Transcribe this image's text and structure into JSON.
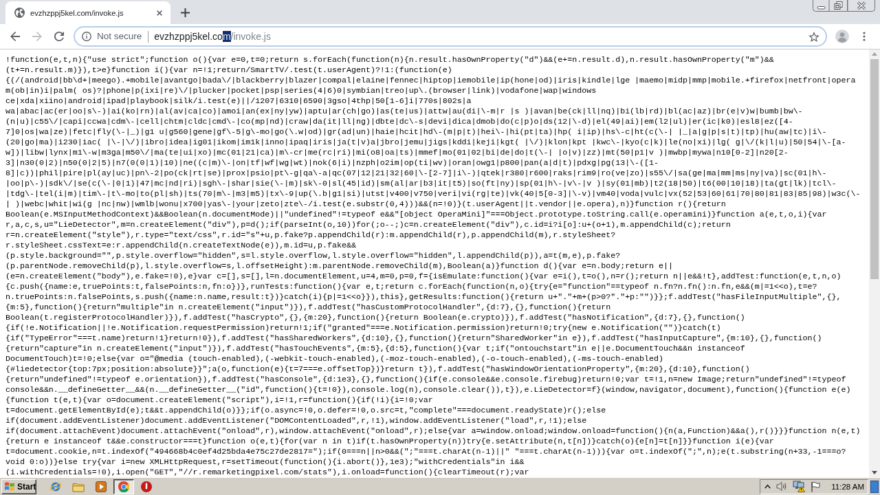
{
  "tabs": [
    {
      "title": "evzhzppj5kel.com/invoke.js",
      "selected": true
    }
  ],
  "toolbar": {
    "nav_buttons": [
      {
        "kind": "back",
        "disabled": false
      },
      {
        "kind": "forward",
        "disabled": true
      },
      {
        "kind": "reload",
        "disabled": false
      }
    ],
    "security_label": "Not secure",
    "url": {
      "host_part": "evzhzppj5kel.co",
      "selected_part": "m",
      "path": "/invoke.js"
    }
  },
  "page": {
    "code_lines": [
      "!function(e,t,n){\"use strict\";function o(){var e=0,t=0;return s.forEach(function(n){n.result.hasOwnProperty(\"d\")&&(e+=n.result.d),n.result.hasOwnProperty(\"m\")&&",
      "(t+=n.result.m)}),t>e}function i(){var n=!1;return/SmartTV/.test(t.userAgent)?!1:(function(e)",
      "{(/(android|bb\\d+|meego).+mobile|avantgo|bada\\/|blackberry|blazer|compal|elaine|fennec|hiptop|iemobile|ip(hone|od)|iris|kindle|lge |maemo|midp|mmp|mobile.+firefox|netfront|opera",
      "m(ob|in)i|palm( os)?|phone|p(ixi|re)\\/|plucker|pocket|psp|series(4|6)0|symbian|treo|up\\.(browser|link)|vodafone|wap|windows",
      "ce|xda|xiino|android|ipad|playbook|silk/i.test(e)||/1207|6310|6590|3gso|4thp|50[1-6]i|770s|802s|a",
      "wa|abac|ac(er|oo|s\\-)|ai(ko|rn)|al(av|ca|co)|amoi|an(ex|ny|yw)|aptu|ar(ch|go)|as(te|us)|attw|au(di|\\-m|r |s )|avan|be(ck|ll|nq)|bi(lb|rd)|bl(ac|az)|br(e|v)w|bumb|bw\\-",
      "(n|u)|c55\\/|capi|ccwa|cdm\\-|cell|chtm|cldc|cmd\\-|co(mp|nd)|craw|da(it|ll|ng)|dbte|dc\\-s|devi|dica|dmob|do(c|p)o|ds(12|\\-d)|el(49|ai)|em(l2|ul)|er(ic|k0)|esl8|ez([4-",
      "7]0|os|wa|ze)|fetc|fly(\\-|_)|g1 u|g560|gene|gf\\-5|g\\-mo|go(\\.w|od)|gr(ad|un)|haie|hcit|hd\\-(m|p|t)|hei\\-|hi(pt|ta)|hp( i|ip)|hs\\-c|ht(c(\\-| |_|a|g|p|s|t)|tp)|hu(aw|tc)|i\\-",
      "(20|go|ma)|i230|iac( |\\-|\\/)|ibro|idea|ig01|ikom|im1k|inno|ipaq|iris|ja(t|v)a|jbro|jemu|jigs|kddi|keji|kgt( |\\/)|klon|kpt |kwc\\-|kyo(c|k)|le(no|xi)|lg( g|\\/(k|l|u)|50|54|\\-[a-",
      "w])|libw|lynx|m1\\-w|m3ga|m50\\/|ma(te|ui|xo)|mc(01|21|ca)|m\\-cr|me(rc|ri)|mi(o8|oa|ts)|mmef|mo(01|02|bi|de|do|t(\\-| |o|v)|zz)|mt(50|p1|v )|mwbp|mywa|n10[0-2]|n20[2-",
      "3]|n30(0|2)|n50(0|2|5)|n7(0(0|1)|10)|ne((c|m)\\-|on|tf|wf|wg|wt)|nok(6|i)|nzph|o2im|op(ti|wv)|oran|owg1|p800|pan(a|d|t)|pdxg|pg(13|\\-([1-",
      "8]|c))|phil|pire|pl(ay|uc)|pn\\-2|po(ck|rt|se)|prox|psio|pt\\-g|qa\\-a|qc(07|12|21|32|60|\\-[2-7]|i\\-)|qtek|r380|r600|raks|rim9|ro(ve|zo)|s55\\/|sa(ge|ma|mm|ms|ny|va)|sc(01|h\\-",
      "|oo|p\\-)|sdk\\/|se(c(\\-|0|1)|47|mc|nd|ri)|sgh\\-|shar|sie(\\-|m)|sk\\-0|sl(45|id)|sm(al|ar|b3|it|t5)|so(ft|ny)|sp(01|h\\-|v\\-|v )|sy(01|mb)|t2(18|50)|t6(00|10|18)|ta(gt|lk)|tcl\\-",
      "|tdg\\-|tel(i|m)|tim\\-|t\\-mo|to(pl|sh)|ts(70|m\\-|m3|m5)|tx\\-9|up(\\.b|g1|si)|utst|v400|v750|veri|vi(rg|te)|vk(40|5[0-3]|\\-v)|vm40|voda|vulc|vx(52|53|60|61|70|80|81|83|85|98)|w3c(\\-",
      "| )|webc|whit|wi(g |nc|nw)|wmlb|wonu|x700|yas\\-|your|zeto|zte\\-/i.test(e.substr(0,4)))&&(n=!0)}(t.userAgent||t.vendor||e.opera),n)}function r(){return",
      "Boolean(e.MSInputMethodContext)&&Boolean(n.documentMode)||\"undefined\"!=typeof e&&\"[object OperaMini]\"===Object.prototype.toString.call(e.operamini)}function a(e,t,o,i){var",
      "r,a,c,s,u=\"LieDetector\",m=n.createElement(\"div\"),p=d();if(parseInt(o,10))for(;o--;)c=n.createElement(\"div\"),c.id=i?i[o]:u+(o+1),m.appendChild(c);return",
      "r=n.createElement(\"style\"),r.type=\"text/css\",r.id=\"s\"+u,p.fake?p.appendChild(r):m.appendChild(r),p.appendChild(m),r.styleSheet?",
      "r.styleSheet.cssText=e:r.appendChild(n.createTextNode(e)),m.id=u,p.fake&&",
      "(p.style.background=\"\",p.style.overflow=\"hidden\",s=l.style.overflow,l.style.overflow=\"hidden\",l.appendChild(p)),a=t(m,e),p.fake?",
      "(p.parentNode.removeChild(p),l.style.overflow=s,l.offsetHeight):m.parentNode.removeChild(m),Boolean(a)}function d(){var e=n.body;return e||",
      "(e=n.createElement(\"body\"),e.fake=!0),e}var c=[],s=[],l=n.documentElement,u=4,m=0,p=0,f={isEmulate:function(){var e=i(),t=o(),n=r();return n||e&&!t},addTest:function(e,t,n,o)",
      "{c.push({name:e,truePoints:t,falsePoints:n,fn:o})},runTests:function(){var e,t;return c.forEach(function(n,o){try{e=\"function\"==typeof n.fn?n.fn():n.fn,e&&(m|=1<<o),t=e?",
      "n.truePoints:n.falsePoints,s.push({name:n.name,result:t})}catch(i){p|=1<<o}}),this},getResults:function(){return u+\".\"+m+(p>0?\".\"+p:\"\")}};f.addTest(\"hasFileInputMultiple\",{},",
      "{m:5},function(){return\"multiple\"in n.createElement(\"input\")}),f.addTest(\"hasCustomProtocolHandler\",{d:7},{},function(){return",
      "Boolean(t.registerProtocolHandler)}),f.addTest(\"hasCrypto\",{},{m:20},function(){return Boolean(e.crypto)}),f.addTest(\"hasNotification\",{d:7},{},function()",
      "{if(!e.Notification||!e.Notification.requestPermission)return!1;if(\"granted\"===e.Notification.permission)return!0;try{new e.Notification(\"\")}catch(t)",
      "{if(\"TypeError\"===t.name)return!1}return!0}),f.addTest(\"hasSharedWorkers\",{d:10},{},function(){return\"SharedWorker\"in e}),f.addTest(\"hasInputCapture\",{m:10},{},function()",
      "{return\"capture\"in n.createElement(\"input\")}),f.addTest(\"hasTouchEvents\",{m:5},{d:5},function(){var t;if(\"ontouchstart\"in e||e.DocumentTouch&&n instanceof",
      "DocumentTouch)t=!0;else{var o=\"@media (touch-enabled),(-webkit-touch-enabled),(-moz-touch-enabled),(-o-touch-enabled),(-ms-touch-enabled)",
      "{#liedetector{top:7px;position:absolute}}\";a(o,function(e){t=7===e.offsetTop})}return t}),f.addTest(\"hasWindowOrientationProperty\",{m:20},{d:10},function()",
      "{return\"undefined\"!=typeof e.orientation}),f.addTest(\"hasConsole\",{d:1e3},{},function(){if(e.console&&e.console.firebug)return!0;var t=!1,n=new Image;return\"undefined\"!=typeof",
      "console&&n.__defineGetter__&&(n.__defineGetter__(\"id\",function(){t=!0}),console.log(n),console.clear()),t}),e.LieDetector=f}(window,navigator,document),function(){function e(e)",
      "{function t(e,t){var o=document.createElement(\"script\"),i=!1,r=function(){if(!i){i=!0;var",
      "t=document.getElementById(e);t&&t.appendChild(o)}};if(o.async=!0,o.defer=!0,o.src=t,\"complete\"===document.readyState)r();else",
      "if(document.addEventListener)document.addEventListener(\"DOMContentLoaded\",r,!1),window.addEventListener(\"load\",r,!1);else",
      "if(document.attachEvent)document.attachEvent(\"onload\",r),window.attachEvent(\"onload\",r);else{var a=window.onload;window.onload=function(){n(a,Function)&&a(),r()}}}function n(e,t)",
      "{return e instanceof t&&e.constructor===t}function o(e,t){for(var n in t)if(t.hasOwnProperty(n))try{e.setAttribute(n,t[n])}catch(o){e[n]=t[n]}}function i(e){var",
      "t=document.cookie,n=t.indexOf(\"494668b4c0ef4d25bda4e75c27de2817=\");if(0===n||n>0&&(\";\"===t.charAt(n-1)||\" \"===t.charAt(n-1))){var o=t.indexOf(\";\",n);e(t.substring(n+33,-1===o?",
      "void 0:o))}else try{var i=new XMLHttpRequest,r=setTimeout(function(){i.abort()},1e3);\"withCredentials\"in i&&",
      "(i.withCredentials=!0),i.open(\"GET\",\"//r.remarketingpixel.com/stats\"),i.onload=function(){clearTimeout(r);var"
    ]
  },
  "taskbar": {
    "start_label": "Start",
    "apps": [
      {
        "kind": "orbit",
        "selected": false
      },
      {
        "kind": "folder",
        "selected": false
      },
      {
        "kind": "play",
        "selected": false
      },
      {
        "kind": "round-logo",
        "selected": true
      },
      {
        "kind": "alert",
        "selected": false
      }
    ],
    "clock": "11:28 AM"
  }
}
